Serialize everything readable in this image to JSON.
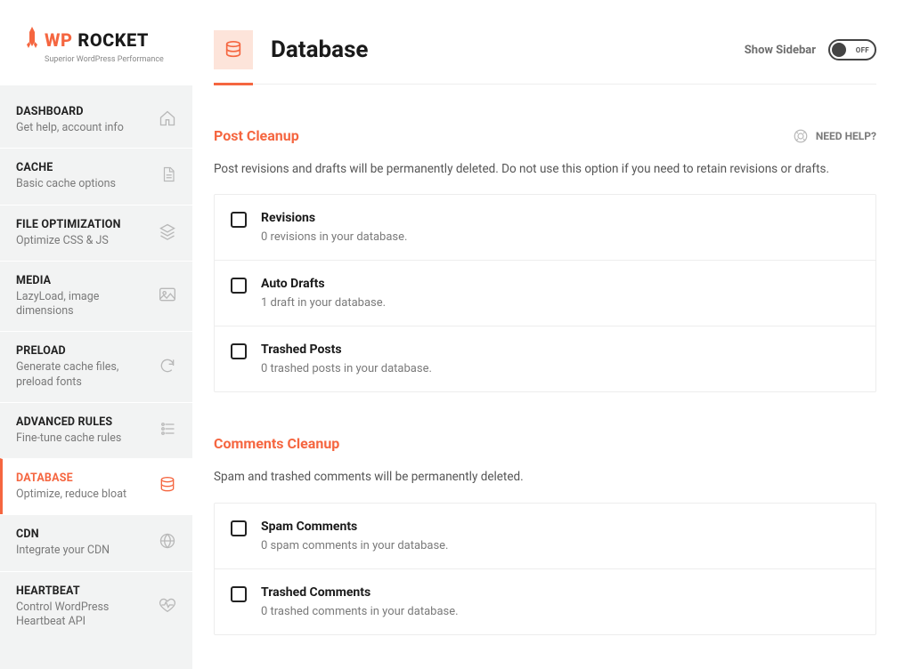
{
  "brand": {
    "name_part1": "WP",
    "name_part2": "ROCKET",
    "tagline": "Superior WordPress Performance"
  },
  "nav": [
    {
      "title": "DASHBOARD",
      "sub": "Get help, account info",
      "icon": "home"
    },
    {
      "title": "CACHE",
      "sub": "Basic cache options",
      "icon": "file"
    },
    {
      "title": "FILE OPTIMIZATION",
      "sub": "Optimize CSS & JS",
      "icon": "layers"
    },
    {
      "title": "MEDIA",
      "sub": "LazyLoad, image dimensions",
      "icon": "image"
    },
    {
      "title": "PRELOAD",
      "sub": "Generate cache files, preload fonts",
      "icon": "refresh"
    },
    {
      "title": "ADVANCED RULES",
      "sub": "Fine-tune cache rules",
      "icon": "sliders"
    },
    {
      "title": "DATABASE",
      "sub": "Optimize, reduce bloat",
      "icon": "database",
      "active": true
    },
    {
      "title": "CDN",
      "sub": "Integrate your CDN",
      "icon": "globe"
    },
    {
      "title": "HEARTBEAT",
      "sub": "Control WordPress Heartbeat API",
      "icon": "heartbeat"
    }
  ],
  "header": {
    "title": "Database",
    "show_sidebar_label": "Show Sidebar",
    "toggle_state": "OFF"
  },
  "help": {
    "label": "NEED HELP?"
  },
  "sections": [
    {
      "title": "Post Cleanup",
      "desc": "Post revisions and drafts will be permanently deleted. Do not use this option if you need to retain revisions or drafts.",
      "options": [
        {
          "title": "Revisions",
          "sub": "0 revisions in your database."
        },
        {
          "title": "Auto Drafts",
          "sub": "1 draft in your database."
        },
        {
          "title": "Trashed Posts",
          "sub": "0 trashed posts in your database."
        }
      ]
    },
    {
      "title": "Comments Cleanup",
      "desc": "Spam and trashed comments will be permanently deleted.",
      "options": [
        {
          "title": "Spam Comments",
          "sub": "0 spam comments in your database."
        },
        {
          "title": "Trashed Comments",
          "sub": "0 trashed comments in your database."
        }
      ]
    }
  ]
}
